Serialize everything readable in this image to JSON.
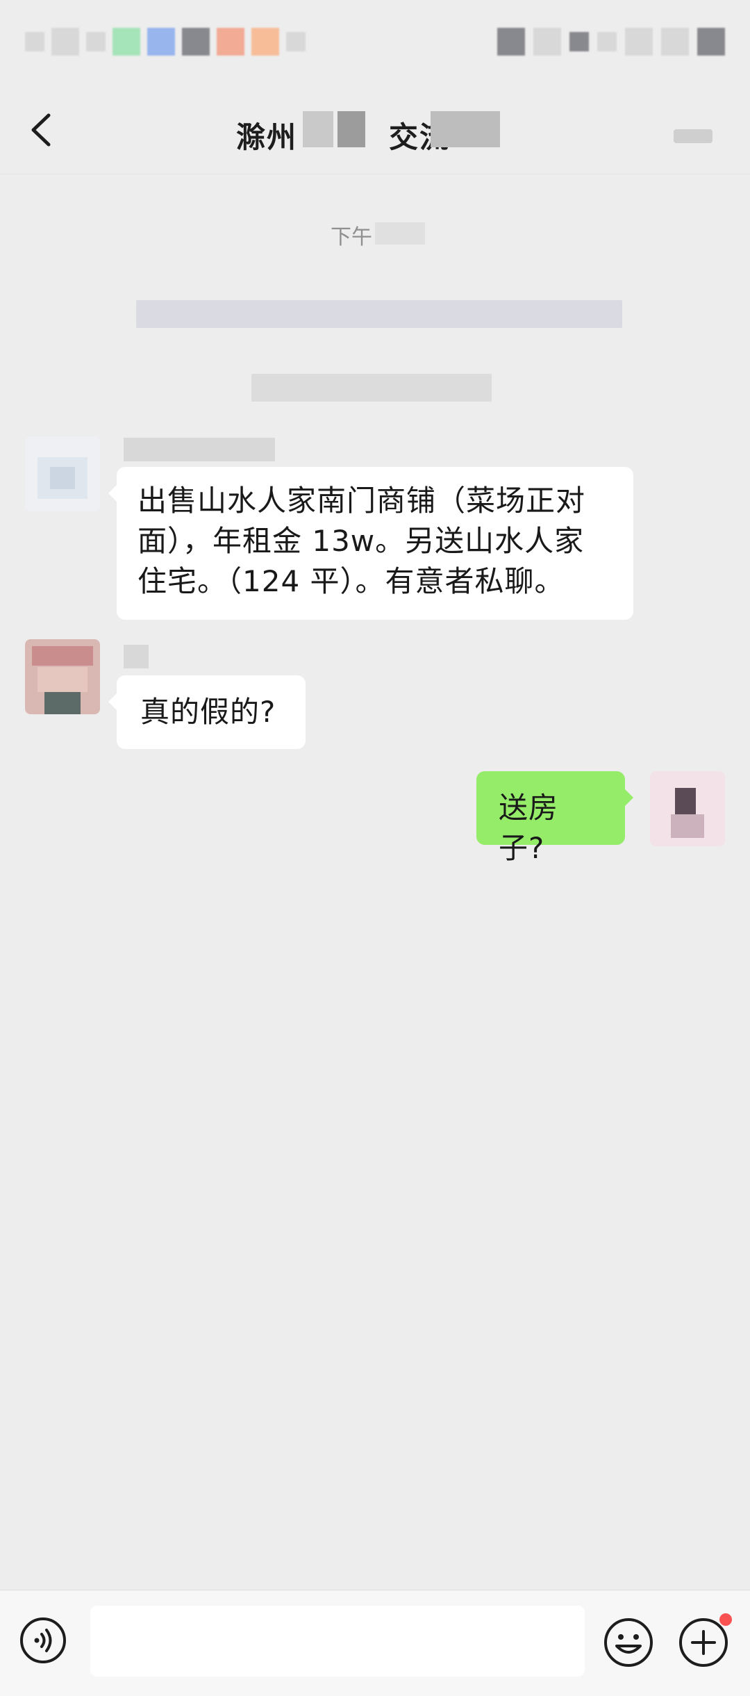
{
  "status_bar": {},
  "header": {
    "title_part1": "滁州",
    "title_part2": "交流",
    "back_icon": "chevron-left-icon",
    "more_icon": "more-icon"
  },
  "chat": {
    "time_label": "下午",
    "messages": [
      {
        "side": "left",
        "lines": [
          "出售山水人家南门商铺（菜场正对",
          "面），年租金 13w。另送山水人家",
          "住宅。（124 平）。有意者私聊。"
        ]
      },
      {
        "side": "left",
        "lines": [
          "真的假的?"
        ]
      },
      {
        "side": "right",
        "lines": [
          "送房子?"
        ]
      }
    ]
  },
  "input_bar": {
    "voice_icon": "voice-icon",
    "input_value": "",
    "emoji_icon": "emoji-icon",
    "plus_icon": "plus-icon",
    "badge_color": "#fa5151"
  },
  "colors": {
    "background": "#ededed",
    "bubble_self": "#95ec69",
    "bubble_other": "#ffffff"
  }
}
